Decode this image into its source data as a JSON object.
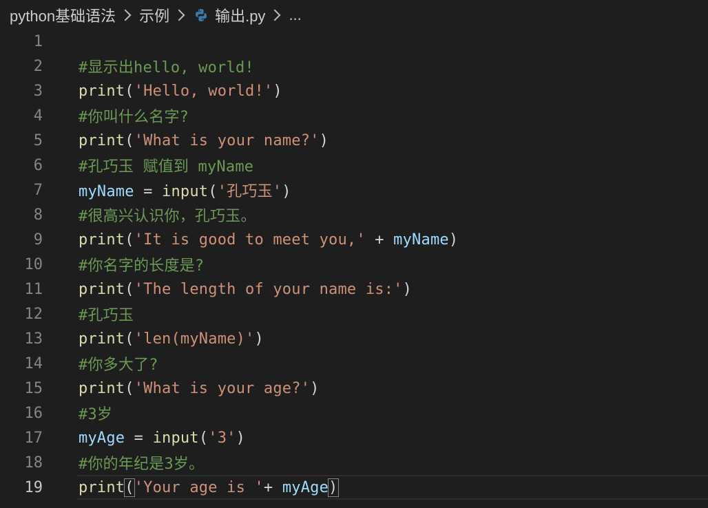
{
  "breadcrumb": {
    "folder": "python基础语法",
    "subfolder": "示例",
    "file": "输出.py",
    "more": "..."
  },
  "colors": {
    "background": "#1e1e1e",
    "comment": "#6a9955",
    "function": "#dcdcaa",
    "string": "#ce9178",
    "variable": "#9cdcfe",
    "python_icon": "#3c78aa"
  },
  "editor": {
    "active_line": 19,
    "lines": [
      {
        "n": "1",
        "tokens": []
      },
      {
        "n": "2",
        "tokens": [
          {
            "t": "#显示出hello, world!",
            "c": "cm"
          }
        ]
      },
      {
        "n": "3",
        "tokens": [
          {
            "t": "print",
            "c": "fn"
          },
          {
            "t": "(",
            "c": "op"
          },
          {
            "t": "'Hello, world!'",
            "c": "str"
          },
          {
            "t": ")",
            "c": "op"
          }
        ]
      },
      {
        "n": "4",
        "tokens": [
          {
            "t": "#你叫什么名字?",
            "c": "cm"
          }
        ]
      },
      {
        "n": "5",
        "tokens": [
          {
            "t": "print",
            "c": "fn"
          },
          {
            "t": "(",
            "c": "op"
          },
          {
            "t": "'What is your name?'",
            "c": "str"
          },
          {
            "t": ")",
            "c": "op"
          }
        ]
      },
      {
        "n": "6",
        "tokens": [
          {
            "t": "#孔巧玉 赋值到 myName",
            "c": "cm"
          }
        ]
      },
      {
        "n": "7",
        "tokens": [
          {
            "t": "myName",
            "c": "var"
          },
          {
            "t": " = ",
            "c": "op"
          },
          {
            "t": "input",
            "c": "fn"
          },
          {
            "t": "(",
            "c": "op"
          },
          {
            "t": "'孔巧玉'",
            "c": "str"
          },
          {
            "t": ")",
            "c": "op"
          }
        ]
      },
      {
        "n": "8",
        "tokens": [
          {
            "t": "#很高兴认识你，孔巧玉。",
            "c": "cm"
          }
        ]
      },
      {
        "n": "9",
        "tokens": [
          {
            "t": "print",
            "c": "fn"
          },
          {
            "t": "(",
            "c": "op"
          },
          {
            "t": "'It is good to meet you,'",
            "c": "str"
          },
          {
            "t": " + ",
            "c": "op"
          },
          {
            "t": "myName",
            "c": "var"
          },
          {
            "t": ")",
            "c": "op"
          }
        ]
      },
      {
        "n": "10",
        "tokens": [
          {
            "t": "#你名字的长度是?",
            "c": "cm"
          }
        ]
      },
      {
        "n": "11",
        "tokens": [
          {
            "t": "print",
            "c": "fn"
          },
          {
            "t": "(",
            "c": "op"
          },
          {
            "t": "'The length of your name is:'",
            "c": "str"
          },
          {
            "t": ")",
            "c": "op"
          }
        ]
      },
      {
        "n": "12",
        "tokens": [
          {
            "t": "#孔巧玉",
            "c": "cm"
          }
        ]
      },
      {
        "n": "13",
        "tokens": [
          {
            "t": "print",
            "c": "fn"
          },
          {
            "t": "(",
            "c": "op"
          },
          {
            "t": "'len(myName)'",
            "c": "str"
          },
          {
            "t": ")",
            "c": "op"
          }
        ]
      },
      {
        "n": "14",
        "tokens": [
          {
            "t": "#你多大了?",
            "c": "cm"
          }
        ]
      },
      {
        "n": "15",
        "tokens": [
          {
            "t": "print",
            "c": "fn"
          },
          {
            "t": "(",
            "c": "op"
          },
          {
            "t": "'What is your age?'",
            "c": "str"
          },
          {
            "t": ")",
            "c": "op"
          }
        ]
      },
      {
        "n": "16",
        "tokens": [
          {
            "t": "#3岁",
            "c": "cm"
          }
        ]
      },
      {
        "n": "17",
        "tokens": [
          {
            "t": "myAge",
            "c": "var"
          },
          {
            "t": " = ",
            "c": "op"
          },
          {
            "t": "input",
            "c": "fn"
          },
          {
            "t": "(",
            "c": "op"
          },
          {
            "t": "'3'",
            "c": "str"
          },
          {
            "t": ")",
            "c": "op"
          }
        ]
      },
      {
        "n": "18",
        "tokens": [
          {
            "t": "#你的年纪是3岁。",
            "c": "cm"
          }
        ]
      },
      {
        "n": "19",
        "tokens": [
          {
            "t": "print",
            "c": "fn"
          },
          {
            "t": "(",
            "c": "op"
          },
          {
            "t": "'Your age is '",
            "c": "str"
          },
          {
            "t": "+ ",
            "c": "op"
          },
          {
            "t": "myAge",
            "c": "var"
          },
          {
            "t": ")",
            "c": "op"
          }
        ]
      }
    ]
  }
}
